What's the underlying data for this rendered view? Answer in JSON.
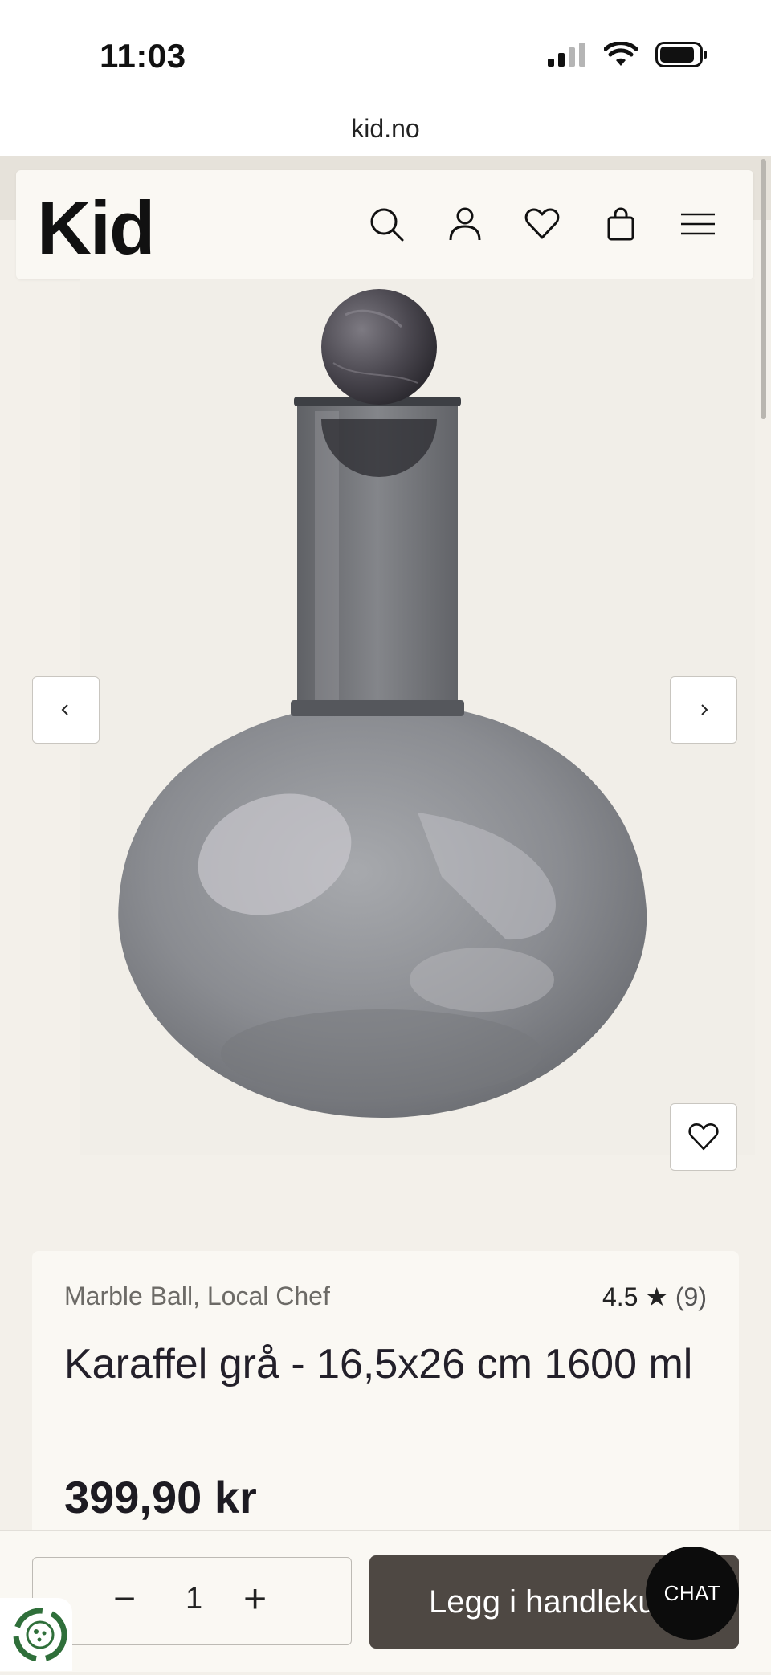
{
  "status_bar": {
    "time": "11:03"
  },
  "browser": {
    "url": "kid.no"
  },
  "header": {
    "logo": "Kid",
    "icons": [
      "search-icon",
      "account-icon",
      "heart-icon",
      "bag-icon",
      "menu-icon"
    ]
  },
  "gallery": {
    "prev_icon": "chevron-left-icon",
    "next_icon": "chevron-right-icon",
    "favorite_icon": "heart-icon"
  },
  "product": {
    "brand": "Marble Ball, Local Chef",
    "rating": "4.5 ★",
    "review_count": "(9)",
    "title": "Karaffel grå - 16,5x26 cm 1600 ml",
    "price": "399,90 kr"
  },
  "cart": {
    "minus": "−",
    "quantity": "1",
    "plus": "+",
    "add_label": "Legg i handlekurv"
  },
  "chat": {
    "label": "CHAT"
  },
  "colors": {
    "accent": "#4e4843",
    "background": "#f3f0ea",
    "card": "#faf8f3"
  }
}
